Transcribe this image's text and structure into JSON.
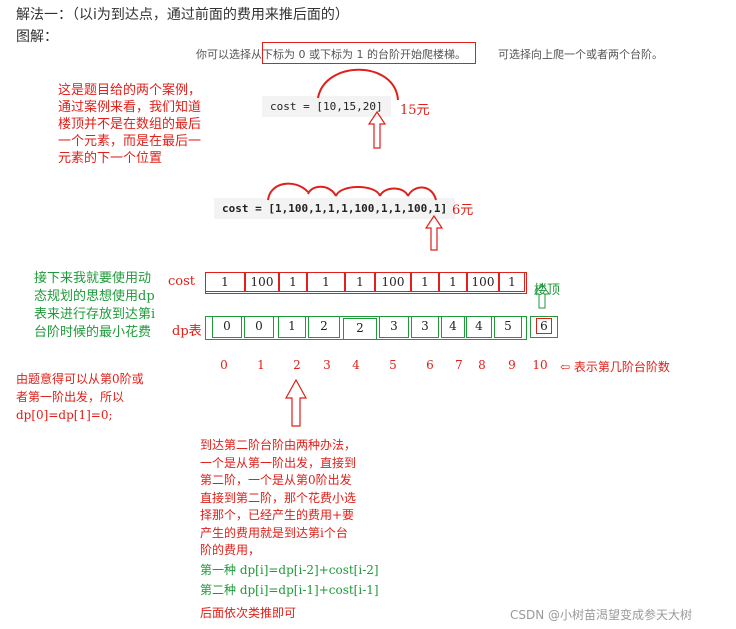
{
  "header": {
    "method_title": "解法一：（以i为到达点，通过前面的费用来推后面的）",
    "diagram_label": "图解："
  },
  "problem": {
    "start_text": "你可以选择从下标为 0 或下标为 1 的台阶开始爬楼梯。",
    "climb_text": "可选择向上爬一个或者两个台阶。"
  },
  "examples": {
    "note_lines": [
      "这是题目给的两个案例，",
      "通过案例来看，我们知道",
      "楼顶并不是在数组的最后",
      "一个元素，而是在最后一",
      "元素的下一个位置"
    ],
    "cost1": "cost = [10,15,20]",
    "cost1_answer": "15元",
    "cost2": "cost = [1,100,1,1,1,100,1,1,100,1]",
    "cost2_answer": "6元"
  },
  "dp_intro_lines": [
    "接下来我就要使用动",
    "态规划的思想使用dp",
    "表来进行存放到达第i",
    "台阶时候的最小花费"
  ],
  "table": {
    "cost_label": "cost",
    "dp_label": "dp表",
    "top_label": "楼顶",
    "cost_values": [
      "1",
      "100",
      "1",
      "1",
      "1",
      "100",
      "1",
      "1",
      "100",
      "1"
    ],
    "dp_values": [
      "0",
      "0",
      "1",
      "2",
      "2",
      "3",
      "3",
      "4",
      "4",
      "5",
      "6"
    ],
    "indices": [
      "0",
      "1",
      "2",
      "3",
      "4",
      "5",
      "6",
      "7",
      "8",
      "9",
      "10"
    ],
    "index_note": "⇦ 表示第几阶台阶数"
  },
  "init_note_lines": [
    "由题意得可以从第0阶或",
    "者第一阶出发，所以",
    "dp[0]=dp[1]=0;"
  ],
  "explain_lines": [
    "到达第二阶台阶由两种办法，",
    "一个是从第一阶出发，直接到",
    "第二阶，一个是从第0阶出发",
    "直接到第二阶，那个花费小选",
    "择那个，已经产生的费用+要",
    "产生的费用就是到达第i个台",
    "阶的费用，"
  ],
  "formula_lines": [
    "第一种 dp[i]=dp[i-2]+cost[i-2]",
    "第二种 dp[i]=dp[i-1]+cost[i-1]"
  ],
  "closing": "后面依次类推即可",
  "watermark": "CSDN @小树苗渴望变成参天大树",
  "colors": {
    "red": "#e0201a",
    "green": "#1f9a3a"
  }
}
